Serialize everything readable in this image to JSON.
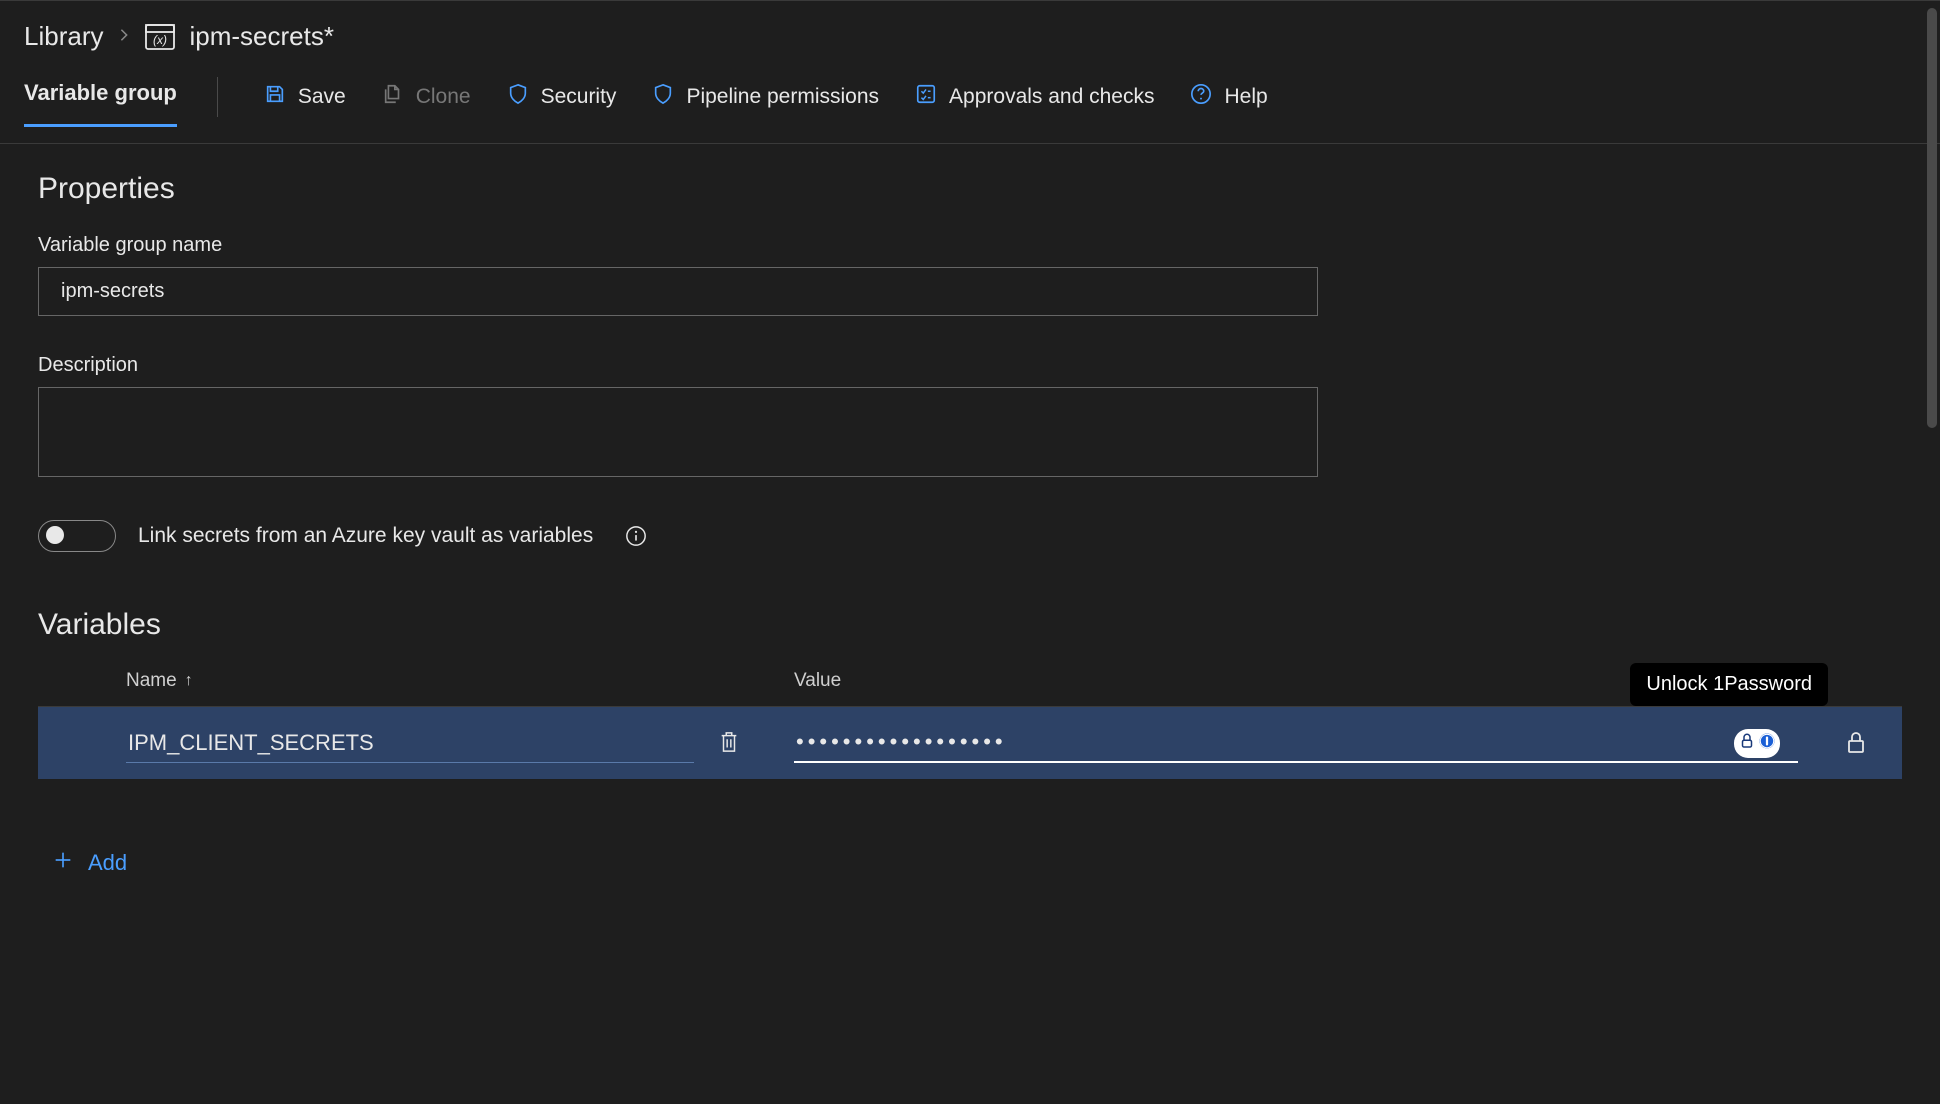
{
  "breadcrumb": {
    "root": "Library",
    "current": "ipm-secrets*"
  },
  "tabs": {
    "variable_group": "Variable group"
  },
  "toolbar": {
    "save": "Save",
    "clone": "Clone",
    "security": "Security",
    "pipeline_permissions": "Pipeline permissions",
    "approvals": "Approvals and checks",
    "help": "Help"
  },
  "sections": {
    "properties": "Properties",
    "variables": "Variables"
  },
  "form": {
    "name_label": "Variable group name",
    "name_value": "ipm-secrets",
    "description_label": "Description",
    "description_value": "",
    "link_secrets_label": "Link secrets from an Azure key vault as variables",
    "link_secrets_on": false
  },
  "vars_table": {
    "headers": {
      "name": "Name",
      "value": "Value"
    },
    "rows": [
      {
        "name": "IPM_CLIENT_SECRETS",
        "value": "••••••••••••••••••",
        "secret": true
      }
    ]
  },
  "onepassword": {
    "tooltip": "Unlock 1Password"
  },
  "add_button": "Add"
}
